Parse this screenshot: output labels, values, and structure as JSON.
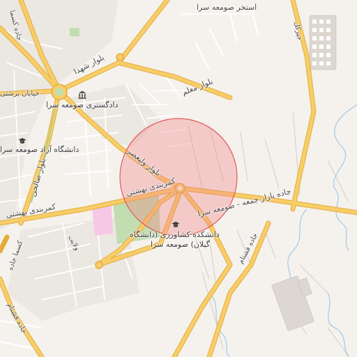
{
  "map": {
    "colors": {
      "land": "#f5f2ee",
      "road_major": "#f6c65a",
      "road_major_edge": "#e3ad3c",
      "road_minor": "#ffffff",
      "road_minor_edge": "#d6d0c8",
      "park": "#b9d8a6",
      "pink_area": "#f7c8e6",
      "water": "#a8cbe6",
      "selection_fill": "#f08a8a",
      "selection_stroke": "#e25a5a"
    },
    "labels": {
      "pool": "استخر صومعه سرا",
      "boulevard_shohada": "بلوار شهدا",
      "boulevard_moalem": "بلوار معلم",
      "street_north": "خیابان برشتی",
      "court": "دادگستری صومعه سرا",
      "azad_university": "دانشگاه آزاد صومعه سرا",
      "boulevard_salehi": "بلوار صالحی",
      "boulevard_valiasr": "بلوار ولیعصر",
      "beltway_left": "کمربندی بهشتی",
      "beltway_center": "کمربندی بهشتی",
      "road_jomeh_sara": "جاده بازار جمعه - صومعه سرا",
      "agriculture_faculty_line1": "دانشکده کشاورزی (دانشگاه",
      "agriculture_faculty_line2": "گیلان) صومعه سرا",
      "velayat": "ولایت",
      "road_fashtam_mid": "جاده فشتام",
      "road_fashtam_bottom": "جاده فشتام",
      "left_road": "جاده کسما",
      "kasma_road": "کسما جاده",
      "right_road": "جیرکل"
    },
    "icons": {
      "court": "bank-icon",
      "azad_university": "graduation-cap-icon",
      "agriculture_faculty": "graduation-cap-icon",
      "roundabout": "roundabout-icon"
    }
  }
}
